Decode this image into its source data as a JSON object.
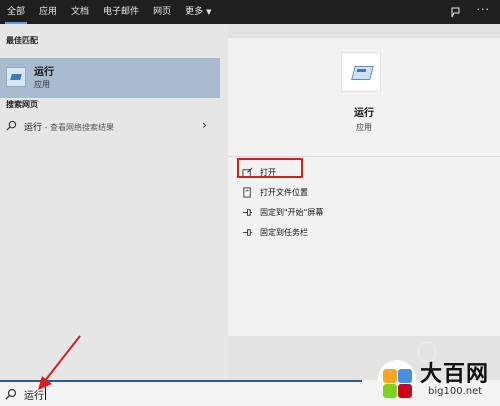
{
  "topbar": {
    "tabs": [
      {
        "label": "全部"
      },
      {
        "label": "应用"
      },
      {
        "label": "文档"
      },
      {
        "label": "电子邮件"
      },
      {
        "label": "网页"
      },
      {
        "label": "更多"
      }
    ],
    "more_menu": "···"
  },
  "left": {
    "best_match_title": "最佳匹配",
    "best_match": {
      "name": "运行",
      "type": "应用"
    },
    "web_title": "搜索网页",
    "web_row": {
      "query": "运行",
      "hint": " - 查看网络搜索结果"
    }
  },
  "right": {
    "name": "运行",
    "type": "应用",
    "actions": [
      {
        "label": "打开"
      },
      {
        "label": "打开文件位置"
      },
      {
        "label": "固定到\"开始\"屏幕"
      },
      {
        "label": "固定到任务栏"
      }
    ]
  },
  "search": {
    "query": "运行"
  },
  "watermark": {
    "brand": "大百网",
    "domain": "big100.net"
  },
  "colors": {
    "accent": "#5aa0e0",
    "highlight": "#a9bccf",
    "annotation": "#d42020"
  }
}
